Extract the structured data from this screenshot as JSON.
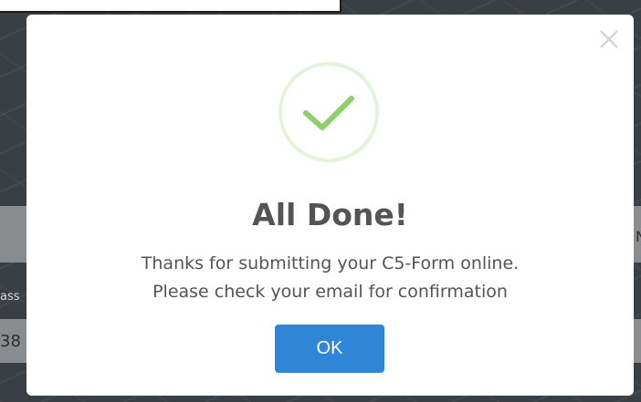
{
  "modal": {
    "title": "All Done!",
    "message_line1": "Thanks for submitting your C5-Form online.",
    "message_line2": "Please check your email for confirmation",
    "ok_label": "OK",
    "icon": "check-mark-icon",
    "close_icon": "close-icon"
  },
  "background": {
    "fragment_left_label": "ass",
    "fragment_left_value": "38",
    "fragment_right": "N"
  },
  "colors": {
    "button": "#3085d6",
    "success_ring": "#e4f3d9",
    "success_check": "#8ccf6b",
    "text": "#545454"
  }
}
